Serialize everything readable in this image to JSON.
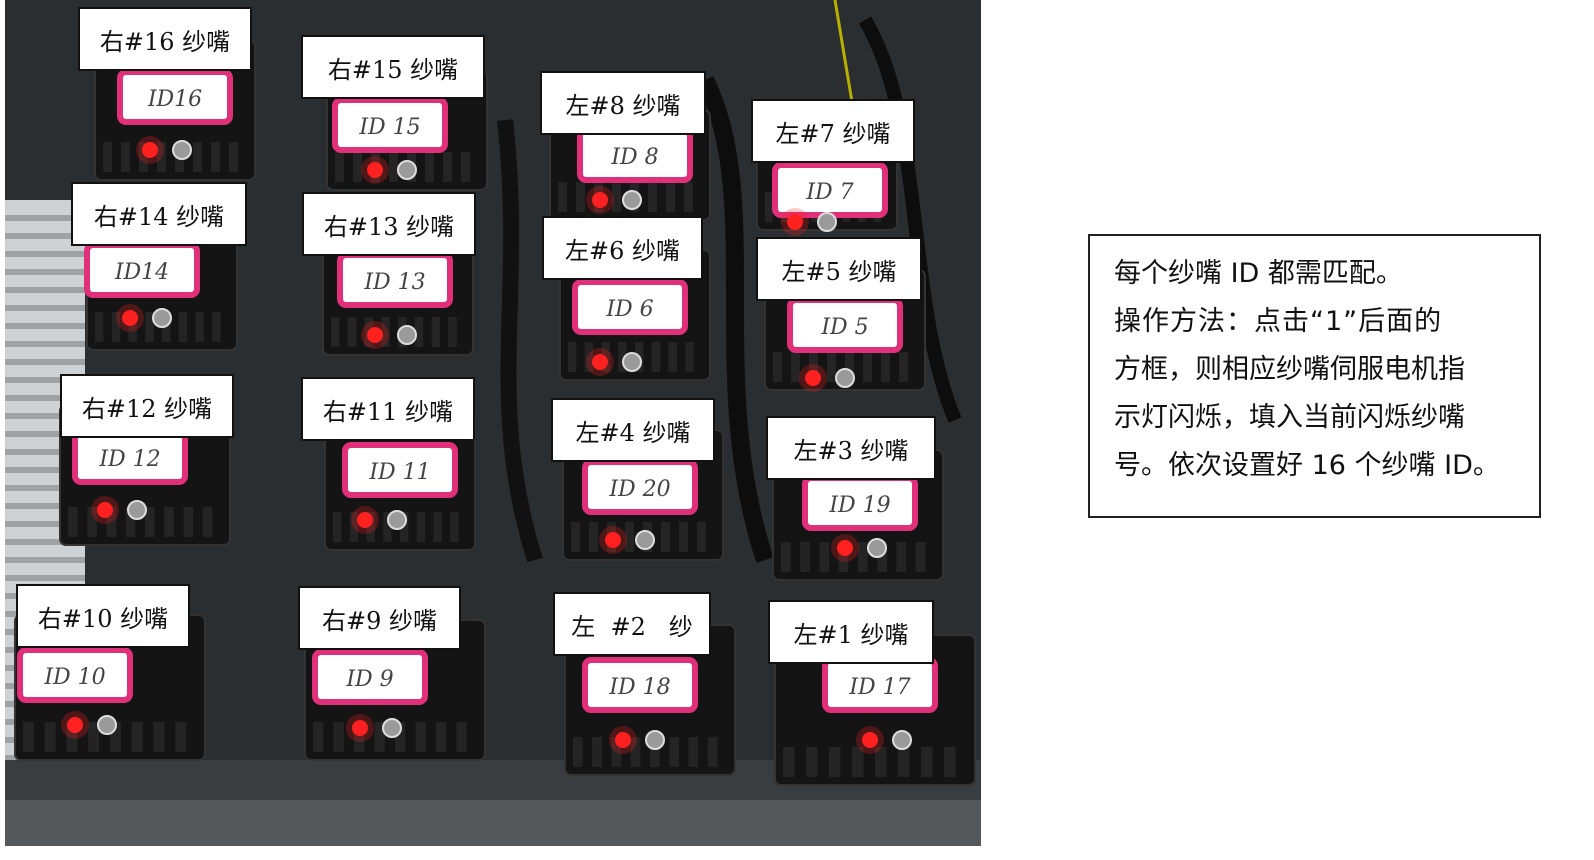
{
  "photo": {
    "labels": {
      "r16": "右#16 纱嘴",
      "r15": "右#15 纱嘴",
      "l8": "左#8 纱嘴",
      "l7": "左#7 纱嘴",
      "r14": "右#14 纱嘴",
      "r13": "右#13 纱嘴",
      "l6": "左#6 纱嘴",
      "l5": "左#5 纱嘴",
      "r12": "右#12 纱嘴",
      "r11": "右#11 纱嘴",
      "l4": "左#4 纱嘴",
      "l3": "左#3 纱嘴",
      "r10": "右#10 纱嘴",
      "r9": "右#9 纱嘴",
      "l2": "左  #2   纱",
      "l1": "左#1 纱嘴"
    },
    "handwritten_tags": {
      "r16": "ID16",
      "r15": "ID 15",
      "l8": "ID 8",
      "l7": "ID 7",
      "r14": "ID14",
      "r13": "ID 13",
      "l6": "ID 6",
      "l5": "ID 5",
      "r12": "ID 12",
      "r11": "ID 11",
      "l4": "ID 20",
      "l3": "ID 19",
      "r10": "ID 10",
      "r9": "ID 9",
      "l2": "ID 18",
      "l1": "ID 17"
    },
    "colors": {
      "tag_border": "#e0307a",
      "led": "#ff2020",
      "motor": "#141414"
    }
  },
  "note": {
    "line1": "每个纱嘴 ID 都需匹配。",
    "line2": "操作方法：点击“1”后面的",
    "line3": "方框，则相应纱嘴伺服电机指",
    "line4": "示灯闪烁，填入当前闪烁纱嘴",
    "line5": "号。依次设置好 16 个纱嘴 ID。"
  }
}
